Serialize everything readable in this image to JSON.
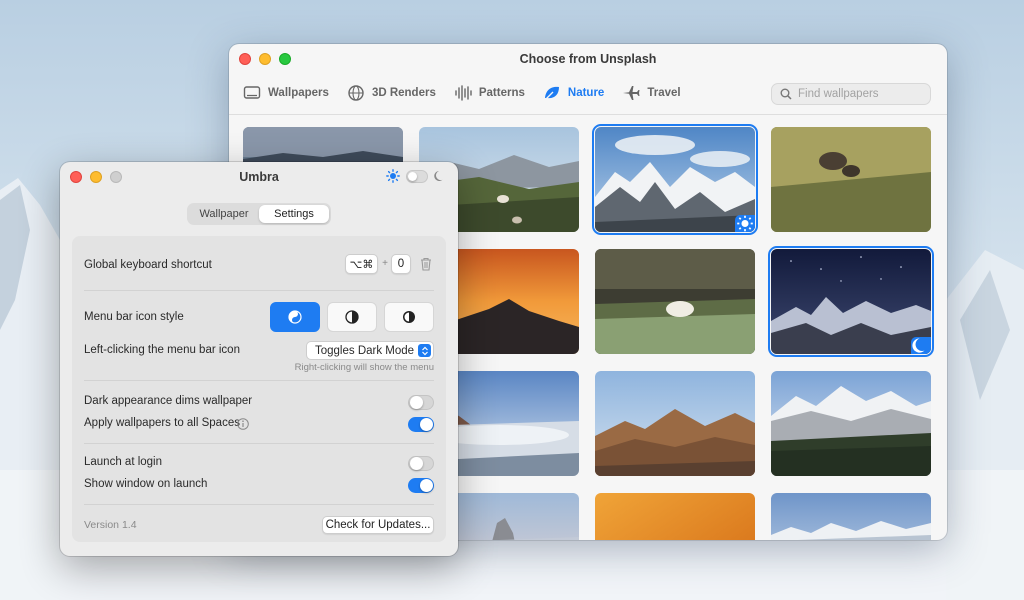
{
  "unsplash": {
    "title": "Choose from Unsplash",
    "categories": [
      {
        "label": "Wallpapers",
        "icon": "monitor-icon",
        "active": false
      },
      {
        "label": "3D Renders",
        "icon": "globe-icon",
        "active": false
      },
      {
        "label": "Patterns",
        "icon": "waveform-icon",
        "active": false
      },
      {
        "label": "Nature",
        "icon": "leaf-icon",
        "active": true
      },
      {
        "label": "Travel",
        "icon": "airplane-icon",
        "active": false
      }
    ],
    "search_placeholder": "Find wallpapers",
    "thumbnails": [
      {
        "scene": "sunset-ridge",
        "selected": false
      },
      {
        "scene": "valley-horses",
        "selected": false
      },
      {
        "scene": "snowy-peaks",
        "selected": true,
        "badge": "sun-icon"
      },
      {
        "scene": "grass-bison",
        "selected": false
      },
      {
        "scene": "sunset-ridge",
        "selected": false
      },
      {
        "scene": "orange-peak",
        "selected": false
      },
      {
        "scene": "cliff-bear",
        "selected": false
      },
      {
        "scene": "night-peaks",
        "selected": true,
        "badge": "moon-icon"
      },
      {
        "scene": "misty-valley",
        "selected": false
      },
      {
        "scene": "misty-valley",
        "selected": false
      },
      {
        "scene": "desert-ridges",
        "selected": false
      },
      {
        "scene": "snow-forest",
        "selected": false
      },
      {
        "scene": "rock-spire",
        "selected": false
      },
      {
        "scene": "rock-spire",
        "selected": false
      },
      {
        "scene": "orange-gradient",
        "selected": false
      },
      {
        "scene": "far-peaks",
        "selected": false
      }
    ]
  },
  "umbra": {
    "title": "Umbra",
    "tabs": [
      {
        "label": "Wallpaper",
        "active": false
      },
      {
        "label": "Settings",
        "active": true
      }
    ],
    "shortcut": {
      "label": "Global keyboard shortcut",
      "keys": "⌥⌘",
      "plus": "+",
      "key": "0"
    },
    "icon_style": {
      "label": "Menu bar icon style",
      "selected_index": 0
    },
    "left_click": {
      "label": "Left-clicking the menu bar icon",
      "value": "Toggles Dark Mode",
      "hint": "Right-clicking will show the menu"
    },
    "dims": {
      "label": "Dark appearance dims wallpaper",
      "on": false
    },
    "all_spaces": {
      "label": "Apply wallpapers to all Spaces",
      "on": true
    },
    "launch_login": {
      "label": "Launch at login",
      "on": false
    },
    "show_window": {
      "label": "Show window on launch",
      "on": true
    },
    "version": "Version 1.4",
    "update_button": "Check for Updates..."
  },
  "colors": {
    "accent": "#1e7cf2",
    "window_bg": "#ececec"
  }
}
